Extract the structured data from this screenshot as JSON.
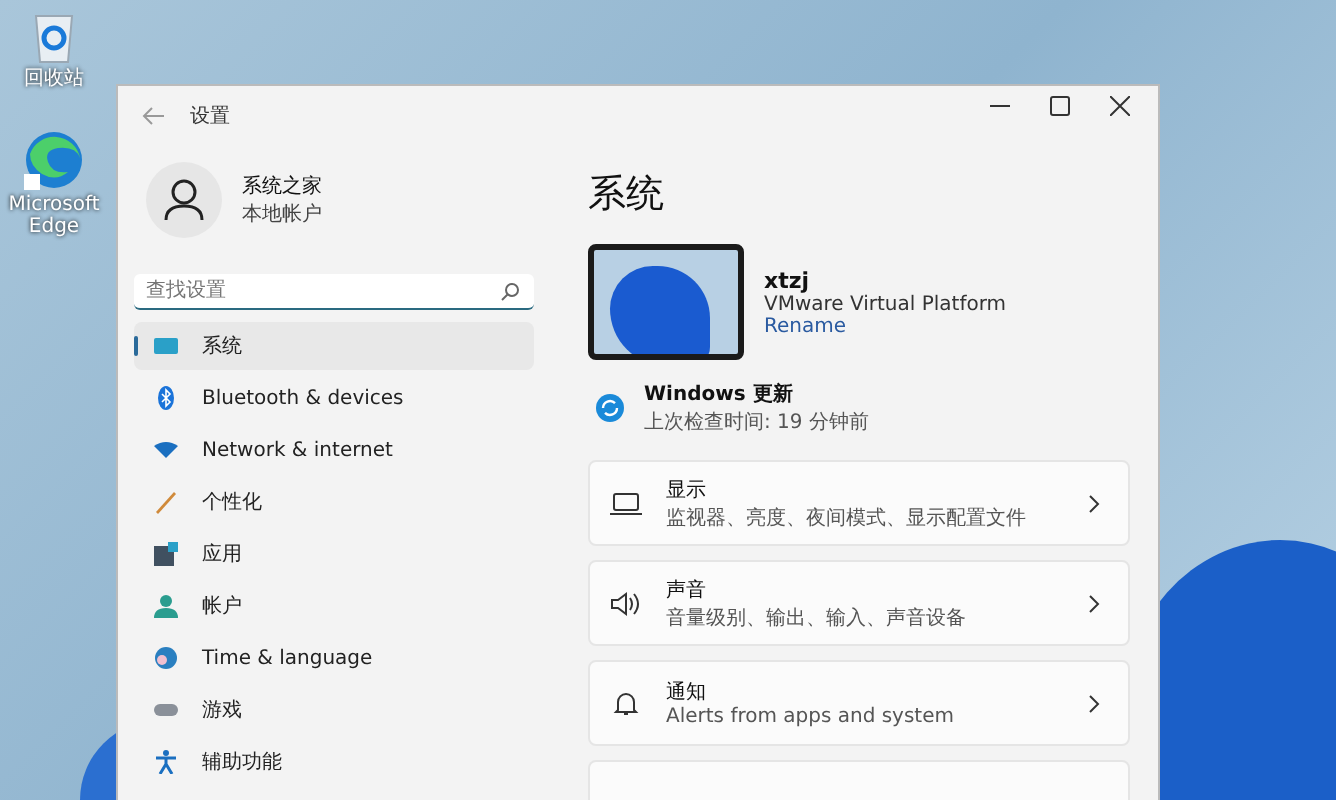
{
  "desktop": {
    "icons": [
      {
        "kind": "recycle",
        "label": "回收站"
      },
      {
        "kind": "browser",
        "label": "Microsoft Edge"
      }
    ]
  },
  "window": {
    "title": "设置"
  },
  "account": {
    "name": "系统之家",
    "type": "本地帐户"
  },
  "search": {
    "placeholder": "查找设置"
  },
  "nav": [
    {
      "kind": "system",
      "label": "系统",
      "selected": true
    },
    {
      "kind": "bluetooth",
      "label": "Bluetooth & devices",
      "selected": false
    },
    {
      "kind": "network",
      "label": "Network & internet",
      "selected": false
    },
    {
      "kind": "personalize",
      "label": "个性化",
      "selected": false
    },
    {
      "kind": "apps",
      "label": "应用",
      "selected": false
    },
    {
      "kind": "account",
      "label": "帐户",
      "selected": false
    },
    {
      "kind": "time",
      "label": "Time & language",
      "selected": false
    },
    {
      "kind": "gaming",
      "label": "游戏",
      "selected": false
    },
    {
      "kind": "accessibility",
      "label": "辅助功能",
      "selected": false
    }
  ],
  "page_title": "系统",
  "device": {
    "name": "xtzj",
    "model": "VMware Virtual Platform",
    "rename": "Rename"
  },
  "update": {
    "title": "Windows 更新",
    "subtitle": "上次检查时间: 19 分钟前"
  },
  "cards": [
    {
      "kind": "display",
      "title": "显示",
      "description": "监视器、亮度、夜间模式、显示配置文件"
    },
    {
      "kind": "sound",
      "title": "声音",
      "description": "音量级别、输出、输入、声音设备"
    },
    {
      "kind": "notifications",
      "title": "通知",
      "description": "Alerts from apps and system"
    }
  ]
}
